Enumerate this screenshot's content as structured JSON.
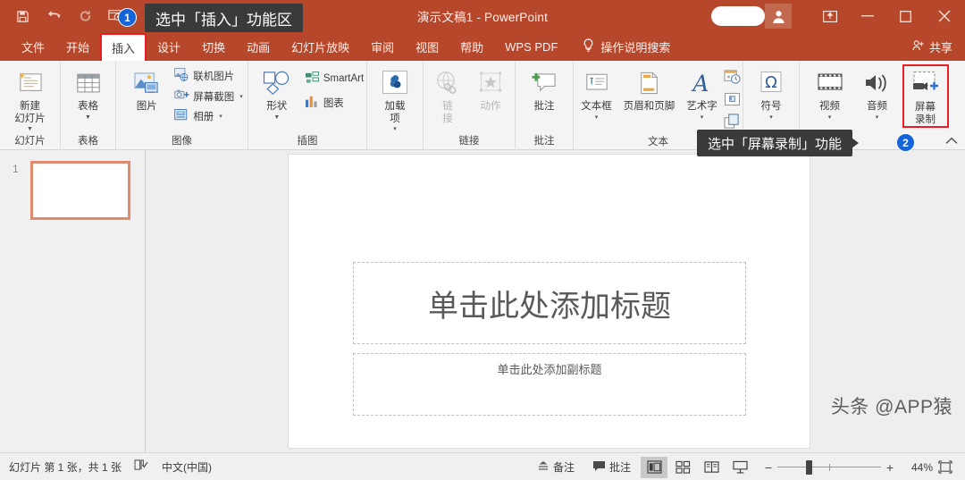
{
  "window": {
    "title": "演示文稿1 - PowerPoint",
    "quick_access": [
      "save-icon",
      "undo-icon",
      "redo-icon",
      "start-from-beginning-icon",
      "customize-qat-icon"
    ],
    "ribbon_display_options": "ribbon-display-options-icon",
    "minimize": "—",
    "maximize": "▢",
    "close": "✕"
  },
  "tabs": [
    {
      "label": "文件",
      "active": false
    },
    {
      "label": "开始",
      "active": false
    },
    {
      "label": "插入",
      "active": true
    },
    {
      "label": "设计",
      "active": false
    },
    {
      "label": "切换",
      "active": false
    },
    {
      "label": "动画",
      "active": false
    },
    {
      "label": "幻灯片放映",
      "active": false
    },
    {
      "label": "审阅",
      "active": false
    },
    {
      "label": "视图",
      "active": false
    },
    {
      "label": "帮助",
      "active": false
    },
    {
      "label": "WPS PDF",
      "active": false
    }
  ],
  "tellme": {
    "label": "操作说明搜索",
    "icon": "lightbulb-icon"
  },
  "share": {
    "label": "共享",
    "icon": "share-person-icon"
  },
  "ribbon": {
    "collapse_icon": "chevron-up-icon",
    "groups": [
      {
        "label": "幻灯片",
        "items": [
          {
            "type": "big",
            "label": "新建\n幻灯片",
            "icon": "new-slide-icon",
            "dropdown": true
          }
        ]
      },
      {
        "label": "表格",
        "items": [
          {
            "type": "big",
            "label": "表格",
            "icon": "table-icon",
            "dropdown": true
          }
        ]
      },
      {
        "label": "图像",
        "items": [
          {
            "type": "big",
            "label": "图片",
            "icon": "picture-icon",
            "dropdown": false
          },
          {
            "type": "small",
            "label": "联机图片",
            "icon": "online-pictures-icon",
            "dropdown": false
          },
          {
            "type": "small",
            "label": "屏幕截图",
            "icon": "screenshot-icon",
            "dropdown": true
          },
          {
            "type": "small",
            "label": "相册",
            "icon": "photo-album-icon",
            "dropdown": true
          }
        ]
      },
      {
        "label": "插图",
        "items": [
          {
            "type": "big",
            "label": "形状",
            "icon": "shapes-icon",
            "dropdown": true
          },
          {
            "type": "small",
            "label": "SmartArt",
            "icon": "smartart-icon",
            "dropdown": false
          },
          {
            "type": "small",
            "label": "图表",
            "icon": "chart-icon",
            "dropdown": false
          }
        ]
      },
      {
        "label": "",
        "items": [
          {
            "type": "big",
            "label": "加载\n项",
            "icon": "add-ins-icon",
            "dropdown": true
          }
        ]
      },
      {
        "label": "链接",
        "items": [
          {
            "type": "big",
            "label": "链\n接",
            "icon": "link-icon",
            "disabled": true
          },
          {
            "type": "big",
            "label": "动作",
            "icon": "action-icon",
            "disabled": true
          }
        ]
      },
      {
        "label": "批注",
        "items": [
          {
            "type": "big",
            "label": "批注",
            "icon": "new-comment-icon",
            "dropdown": false
          }
        ]
      },
      {
        "label": "文本",
        "items": [
          {
            "type": "big",
            "label": "文本框",
            "icon": "text-box-icon",
            "dropdown": true
          },
          {
            "type": "big",
            "label": "页眉和页脚",
            "icon": "header-footer-icon",
            "dropdown": false
          },
          {
            "type": "big",
            "label": "艺术字",
            "icon": "wordart-icon",
            "dropdown": true
          },
          {
            "type": "iconcol",
            "icons": [
              "date-time-icon",
              "slide-number-icon",
              "object-icon"
            ]
          }
        ]
      },
      {
        "label": "",
        "items": [
          {
            "type": "big",
            "label": "符号",
            "icon": "symbol-icon",
            "dropdown": true
          }
        ]
      },
      {
        "label": "",
        "items": [
          {
            "type": "big",
            "label": "视频",
            "icon": "video-icon",
            "dropdown": true
          },
          {
            "type": "big",
            "label": "音频",
            "icon": "audio-icon",
            "dropdown": true
          },
          {
            "type": "big",
            "label": "屏幕\n录制",
            "icon": "screen-recording-icon",
            "highlighted": true
          }
        ]
      }
    ]
  },
  "callouts": [
    {
      "text": "选中「插入」功能区",
      "badge": "1"
    },
    {
      "text": "选中「屏幕录制」功能",
      "badge": "2"
    }
  ],
  "thumbnails": [
    {
      "number": "1",
      "selected": true
    }
  ],
  "slide": {
    "title_placeholder": "单击此处添加标题",
    "subtitle_placeholder": "单击此处添加副标题"
  },
  "watermark": "头条 @APP猿",
  "statusbar": {
    "slide_info": "幻灯片 第 1 张，共 1 张",
    "spellcheck_icon": "proofing-icon",
    "language": "中文(中国)",
    "notes": {
      "label": "备注",
      "icon": "notes-icon"
    },
    "comments": {
      "label": "批注",
      "icon": "comments-icon"
    },
    "views": [
      {
        "name": "normal-view",
        "icon": "normal-view-icon",
        "active": true
      },
      {
        "name": "slide-sorter-view",
        "icon": "slide-sorter-icon",
        "active": false
      },
      {
        "name": "reading-view",
        "icon": "reading-view-icon",
        "active": false
      },
      {
        "name": "slideshow-view",
        "icon": "slideshow-icon",
        "active": false
      }
    ],
    "zoom_out": "−",
    "zoom_in": "+",
    "zoom_value": "44%",
    "fit_to_window": "fit-slide-icon"
  },
  "colors": {
    "titlebar": "#b7472a",
    "accent_red": "#ec1c24",
    "badge_blue": "#1565d8",
    "callout_bg": "#3b3a3a",
    "thumb_select": "#e08a6e"
  }
}
